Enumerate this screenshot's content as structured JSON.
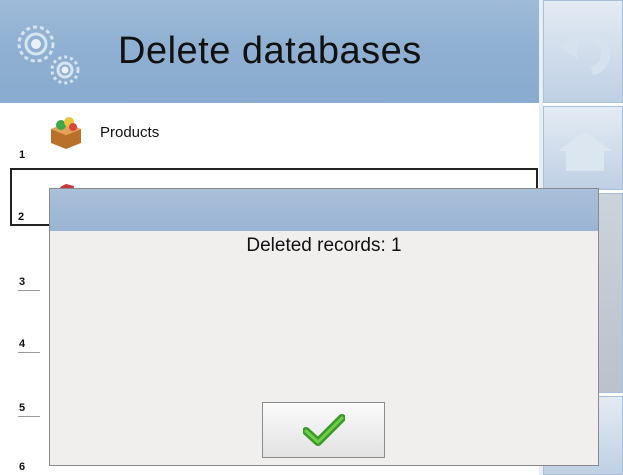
{
  "header": {
    "title": "Delete databases"
  },
  "list": {
    "items": [
      {
        "number": "1",
        "label": "Products"
      },
      {
        "number": "2",
        "label": ""
      },
      {
        "number": "3",
        "label": ""
      },
      {
        "number": "4",
        "label": ""
      },
      {
        "number": "5",
        "label": ""
      },
      {
        "number": "6",
        "label": ""
      }
    ]
  },
  "dialog": {
    "message": "Deleted records: 1"
  },
  "icons": {
    "header": "gears-icon",
    "back": "back-arrow-icon",
    "home": "home-icon",
    "products": "products-box-icon",
    "ok": "checkmark-icon"
  },
  "colors": {
    "accent": "#8fb0d2",
    "ok": "#3a9a2a"
  }
}
